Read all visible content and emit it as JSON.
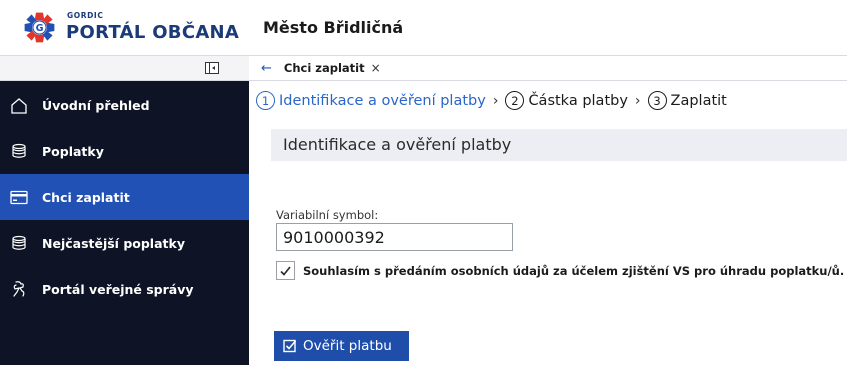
{
  "brand": {
    "company": "GORDIC",
    "portal": "PORTÁL OBČANA"
  },
  "sidebar": {
    "items": [
      {
        "label": "Úvodní přehled",
        "icon": "home-icon"
      },
      {
        "label": "Poplatky",
        "icon": "coins-icon"
      },
      {
        "label": "Chci zaplatit",
        "icon": "card-icon",
        "active": true
      },
      {
        "label": "Nejčastější poplatky",
        "icon": "coins-icon"
      },
      {
        "label": "Portál veřejné správy",
        "icon": "lion-emblem-icon"
      }
    ]
  },
  "header": {
    "city": "Město Břidličná"
  },
  "tabs": {
    "back": "←",
    "active_tab": "Chci zaplatit",
    "close": "×"
  },
  "steps": [
    {
      "num": "1",
      "label": "Identifikace a ověření platby",
      "current": true
    },
    {
      "num": "2",
      "label": "Částka platby"
    },
    {
      "num": "3",
      "label": "Zaplatit"
    }
  ],
  "step_separator": "›",
  "form": {
    "section_title": "Identifikace a ověření platby",
    "vs_label": "Variabilní symbol:",
    "vs_value": "9010000392",
    "consent_text": "Souhlasím s předáním osobních údajů za účelem zjištění VS pro úhradu poplatku/ů.",
    "consent_checked": true,
    "submit_label": "Ověřit platbu"
  },
  "colors": {
    "sidebar_bg": "#0e1426",
    "active_item": "#2251b5",
    "step_current": "#2a66c9",
    "button": "#1f4eaa",
    "section_bg": "#eceef4"
  }
}
